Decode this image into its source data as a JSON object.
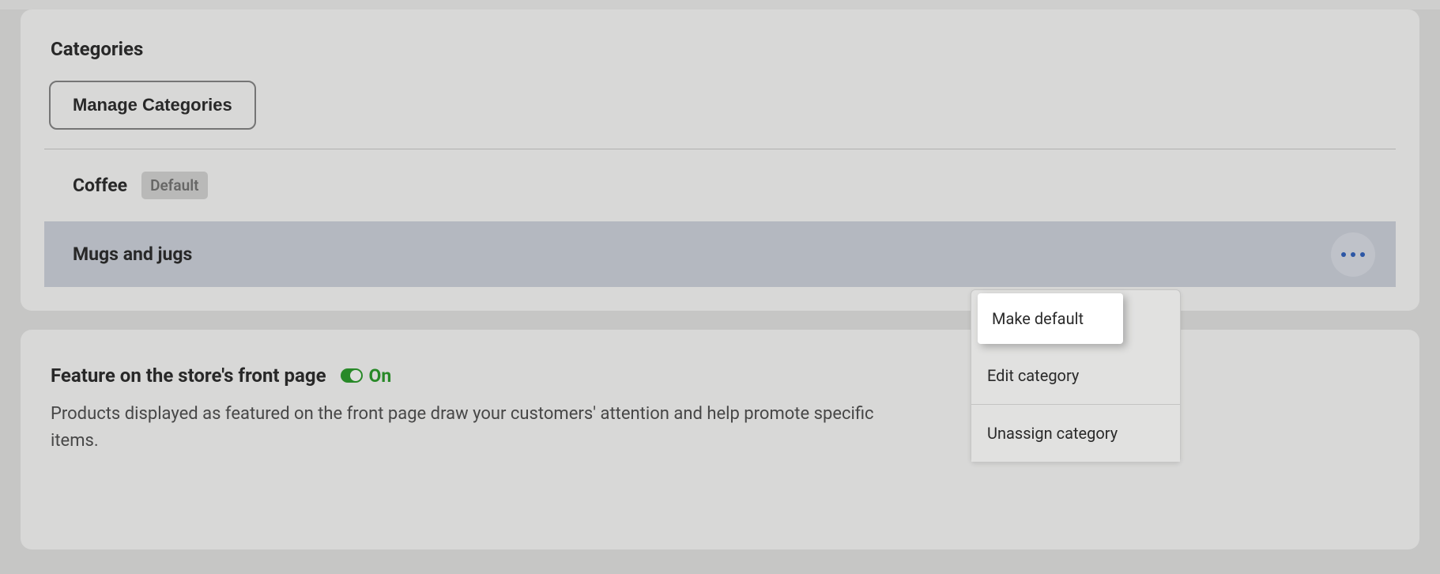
{
  "categories": {
    "title": "Categories",
    "manage_btn": "Manage Categories",
    "items": [
      {
        "name": "Coffee",
        "default_badge": "Default"
      },
      {
        "name": "Mugs and jugs"
      }
    ]
  },
  "feature": {
    "title": "Feature on the store's front page",
    "toggle_state": "On",
    "description": "Products displayed as featured on the front page draw your customers' attention and help promote specific items."
  },
  "popup": {
    "make_default": "Make default",
    "edit_category": "Edit category",
    "unassign_category": "Unassign category"
  }
}
